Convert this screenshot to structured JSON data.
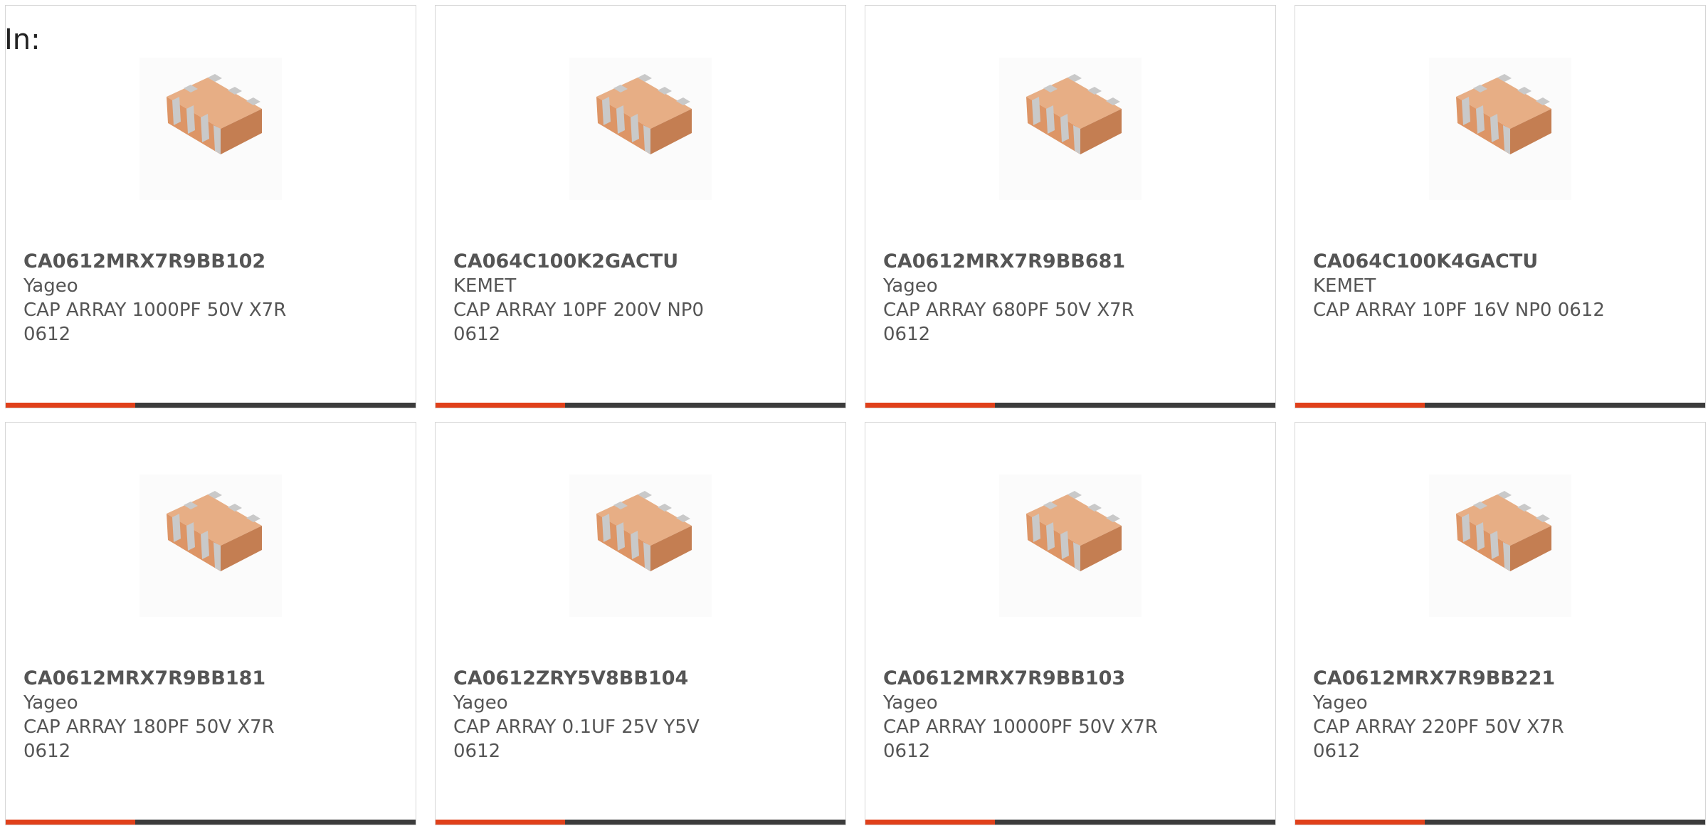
{
  "heading": "In:",
  "colors": {
    "accent": "#e0401a",
    "bar": "#3b3b3b",
    "text": "#555555",
    "border": "#d6d6d6",
    "chip_body": "#e3a070",
    "chip_terminal": "#c9c9c9"
  },
  "product_image_icon": "capacitor-array-chip-icon",
  "products": [
    {
      "part_number": "CA0612MRX7R9BB102",
      "manufacturer": "Yageo",
      "description_line1": "CAP ARRAY 1000PF 50V X7R",
      "description_line2": "0612"
    },
    {
      "part_number": "CA064C100K2GACTU",
      "manufacturer": "KEMET",
      "description_line1": "CAP ARRAY 10PF 200V NP0 0612",
      "description_line2": ""
    },
    {
      "part_number": "CA0612MRX7R9BB681",
      "manufacturer": "Yageo",
      "description_line1": "CAP ARRAY 680PF 50V X7R 0612",
      "description_line2": ""
    },
    {
      "part_number": "CA064C100K4GACTU",
      "manufacturer": "KEMET",
      "description_line1": "CAP ARRAY 10PF 16V NP0 0612",
      "description_line2": ""
    },
    {
      "part_number": "CA0612MRX7R9BB181",
      "manufacturer": "Yageo",
      "description_line1": "CAP ARRAY 180PF 50V X7R 0612",
      "description_line2": ""
    },
    {
      "part_number": "CA0612ZRY5V8BB104",
      "manufacturer": "Yageo",
      "description_line1": "CAP ARRAY 0.1UF 25V Y5V 0612",
      "description_line2": ""
    },
    {
      "part_number": "CA0612MRX7R9BB103",
      "manufacturer": "Yageo",
      "description_line1": "CAP ARRAY 10000PF 50V X7R",
      "description_line2": "0612"
    },
    {
      "part_number": "CA0612MRX7R9BB221",
      "manufacturer": "Yageo",
      "description_line1": "CAP ARRAY 220PF 50V X7R 0612",
      "description_line2": ""
    }
  ]
}
